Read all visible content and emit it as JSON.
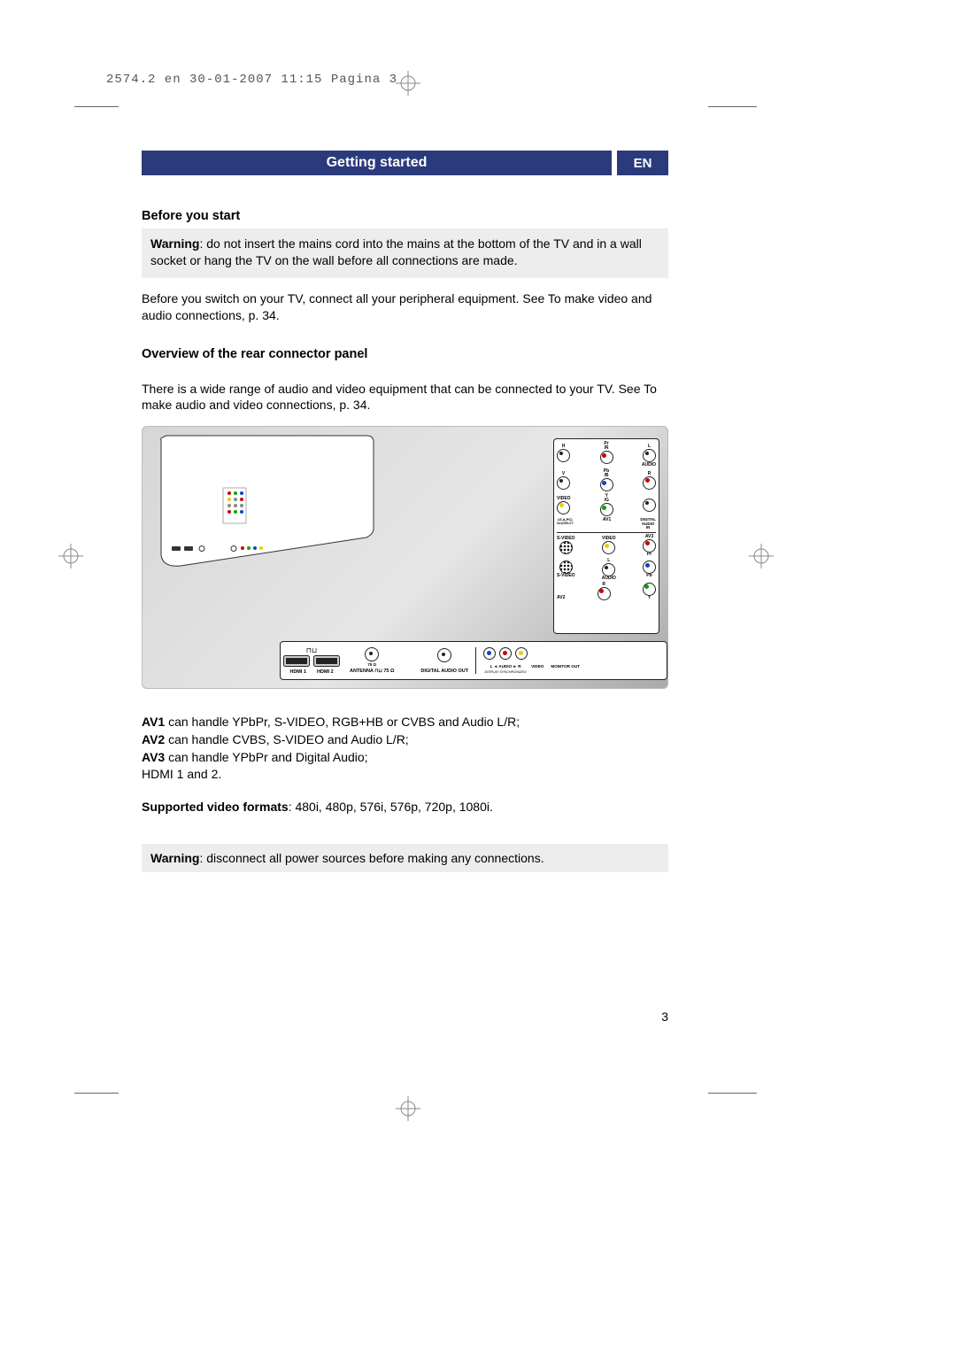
{
  "print_meta": "2574.2 en  30-01-2007  11:15  Pagina 3",
  "header": {
    "title": "Getting started",
    "lang": "EN"
  },
  "sections": {
    "before": {
      "heading": "Before you start",
      "warning_label": "Warning",
      "warning_text": ": do not insert the mains cord into the mains at the bottom of the TV and in a wall socket or hang the TV on the wall before all connections are made.",
      "body": "Before you switch on your TV, connect all your peripheral equipment. See To make video and audio connections, p. 34."
    },
    "overview": {
      "heading": "Overview of the rear connector panel",
      "body": "There is a wide range of audio and video equipment that can be connected to your TV.  See To make audio and video connections, p. 34."
    }
  },
  "diagram": {
    "right_panel": {
      "rows": [
        {
          "l": "H",
          "c": "Pr /G",
          "c_color": "red",
          "r": "L"
        },
        {
          "l": "V",
          "c": "Pb /B",
          "c_color": "blue",
          "r": "R",
          "r_color": "red"
        },
        {
          "l": "VIDEO",
          "l_color": "yellow",
          "c": "Y /G",
          "c_color": "green",
          "r": ""
        },
        {
          "sub_l": "(G,A,PC) xx@50-#?",
          "sub_c": "AV1",
          "sub_r": "DIGITAL AUDIO IN"
        }
      ],
      "middle": {
        "l": "S-VIDEO",
        "c": "VIDEO",
        "c_color": "yellow",
        "r": "AV3",
        "pr": "Pr",
        "pr_color": "red",
        "pb": "Pb",
        "pb_color": "blue",
        "y": "Y",
        "y_color": "green"
      },
      "bottom": {
        "l": "S-VIDEO",
        "c": "AUDIO",
        "r": "",
        "av": "AV2"
      }
    },
    "bottom_strip": {
      "hdmi1": "HDMI 1",
      "hdmi2": "HDMI 2",
      "antenna": "ANTENNA ⊓⊔ 75 Ω",
      "ant_ohm": "75 Ω",
      "digital_audio": "DIGITAL AUDIO OUT",
      "audio_lr": "L ◄ AUDIO ► R",
      "display_sync": "DISPLAY SYNCHRONIZED",
      "video": "VIDEO",
      "monitor": "MONITOR OUT"
    }
  },
  "av": {
    "av1_label": "AV1",
    "av1_text": " can handle YPbPr, S-VIDEO, RGB+HB or CVBS and Audio L/R;",
    "av2_label": "AV2",
    "av2_text": " can handle CVBS, S-VIDEO and Audio L/R;",
    "av3_label": "AV3",
    "av3_text": " can handle YPbPr and Digital Audio;",
    "hdmi": "HDMI 1 and 2."
  },
  "formats": {
    "label": "Supported video formats",
    "text": ": 480i, 480p, 576i, 576p, 720p, 1080i."
  },
  "warning2": {
    "label": "Warning",
    "text": ": disconnect all power sources before making any connections."
  },
  "page_number": "3"
}
